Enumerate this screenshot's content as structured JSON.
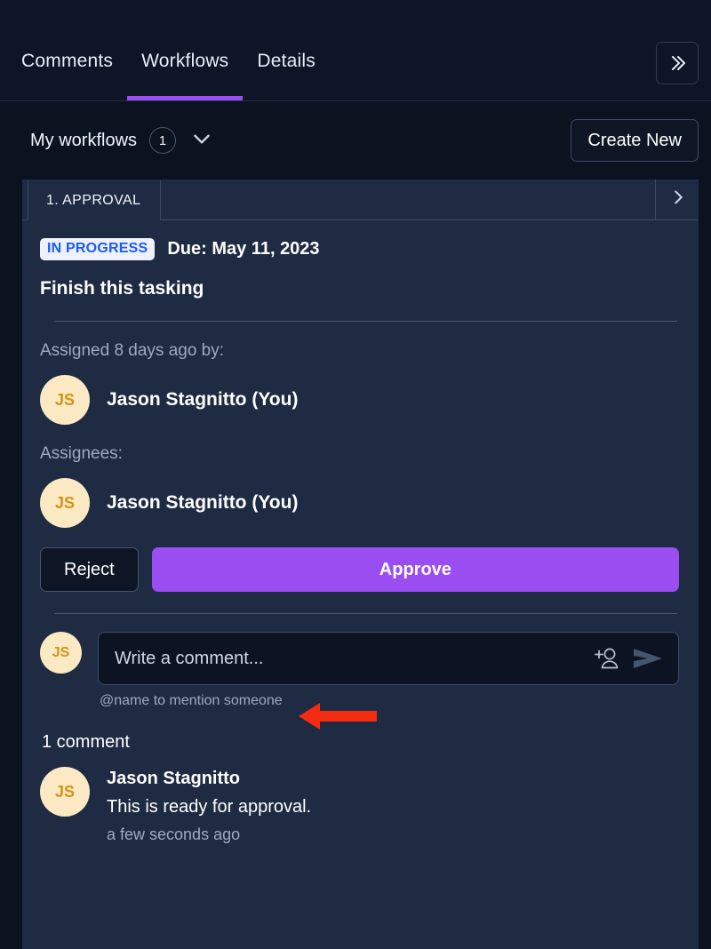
{
  "tabbar": {
    "tabs": [
      {
        "label": "Comments",
        "active": false
      },
      {
        "label": "Workflows",
        "active": true
      },
      {
        "label": "Details",
        "active": false
      }
    ],
    "collapse_icon": "chevron-double-right-icon",
    "accent_color": "#9a4df0"
  },
  "subheader": {
    "title": "My workflows",
    "count": "1",
    "caret_icon": "chevron-down-icon",
    "create_label": "Create New"
  },
  "workflow": {
    "step_tab": "1. APPROVAL",
    "next_icon": "chevron-right-icon",
    "status_badge": "IN PROGRESS",
    "status_badge_bg": "#eef1fb",
    "status_badge_color": "#1a5cf5",
    "due": "Due: May 11, 2023",
    "task_title": "Finish this tasking",
    "assigned_label": "Assigned 8 days ago by:",
    "assigner": {
      "initials": "JS",
      "name": "Jason Stagnitto (You)"
    },
    "assignees_label": "Assignees:",
    "assignees": [
      {
        "initials": "JS",
        "name": "Jason Stagnitto (You)"
      }
    ],
    "reject_label": "Reject",
    "approve_label": "Approve",
    "approve_color": "#9a4df0"
  },
  "composer": {
    "avatar_initials": "JS",
    "placeholder": "Write a comment...",
    "mention_icon": "add-person-icon",
    "send_icon": "send-icon",
    "hint": "@name to mention someone"
  },
  "comments": {
    "count_label": "1 comment",
    "items": [
      {
        "initials": "JS",
        "author": "Jason Stagnitto",
        "text": "This is ready for approval.",
        "time": "a few seconds ago"
      }
    ]
  },
  "annotation": {
    "arrow_color": "#f52b12",
    "arrow_direction": "left"
  }
}
